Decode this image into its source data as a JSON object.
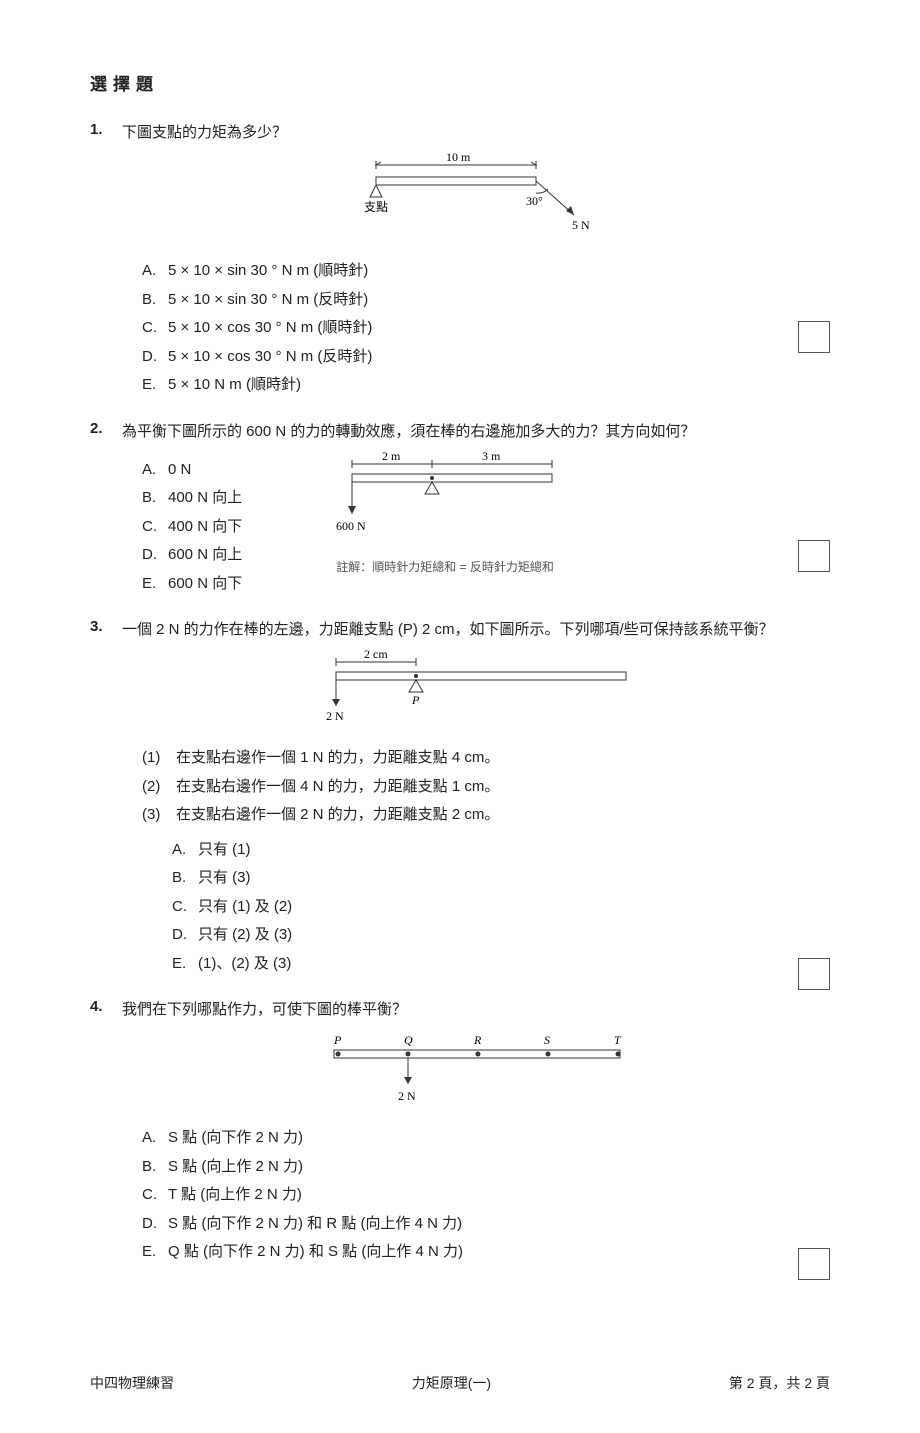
{
  "section_title": "選擇題",
  "questions": [
    {
      "num": "1.",
      "stem": "下圖支點的力矩為多少？",
      "diagram": {
        "beam_len_label": "10 m",
        "fulcrum_label": "支點",
        "angle_label": "30°",
        "force_label": "5 N"
      },
      "options": [
        "5 × 10 × sin 30 °  N m (順時針)",
        "5 × 10 × sin 30 °  N m (反時針)",
        "5 × 10 × cos 30 °  N m (順時針)",
        "5 × 10 × cos 30 °  N m (反時針)",
        "5 × 10 N m (順時針)"
      ]
    },
    {
      "num": "2.",
      "stem": "為平衡下圖所示的 600 N 的力的轉動效應，須在棒的右邊施加多大的力？其方向如何？",
      "diagram": {
        "left_seg": "2 m",
        "right_seg": "3 m",
        "force_label": "600 N",
        "hint": "註解：順時針力矩總和 = 反時針力矩總和"
      },
      "options": [
        "0 N",
        "400 N 向上",
        "400 N 向下",
        "600 N 向上",
        "600 N 向下"
      ]
    },
    {
      "num": "3.",
      "stem": "一個 2 N 的力作在棒的左邊，力距離支點 (P) 2 cm，如下圖所示。下列哪項/些可保持該系統平衡？",
      "diagram": {
        "left_seg": "2 cm",
        "pivot_label": "P",
        "force_label": "2 N"
      },
      "statements": [
        "在支點右邊作一個 1 N 的力，力距離支點 4 cm。",
        "在支點右邊作一個 4 N 的力，力距離支點 1 cm。",
        "在支點右邊作一個 2 N 的力，力距離支點 2 cm。"
      ],
      "options": [
        "只有 (1)",
        "只有 (3)",
        "只有 (1) 及 (2)",
        "只有 (2) 及 (3)",
        "(1)、(2) 及 (3)"
      ]
    },
    {
      "num": "4.",
      "stem": "我們在下列哪點作力，可使下圖的棒平衡？",
      "diagram": {
        "points": [
          "P",
          "Q",
          "R",
          "S",
          "T"
        ],
        "force_label": "2 N"
      },
      "options": [
        "S 點 (向下作 2 N 力)",
        "S 點 (向上作 2 N 力)",
        "T 點 (向上作 2 N 力)",
        "S 點 (向下作 2 N 力) 和 R 點 (向上作 4 N 力)",
        "Q 點 (向下作 2 N 力) 和 S 點 (向上作 4 N 力)"
      ]
    }
  ],
  "opt_letters": [
    "A.",
    "B.",
    "C.",
    "D.",
    "E."
  ],
  "stmt_labels": [
    "(1)",
    "(2)",
    "(3)"
  ],
  "footer": {
    "left": "中四物理練習",
    "center": "力矩原理(一)",
    "right": "第 2 頁，共 2 頁"
  }
}
